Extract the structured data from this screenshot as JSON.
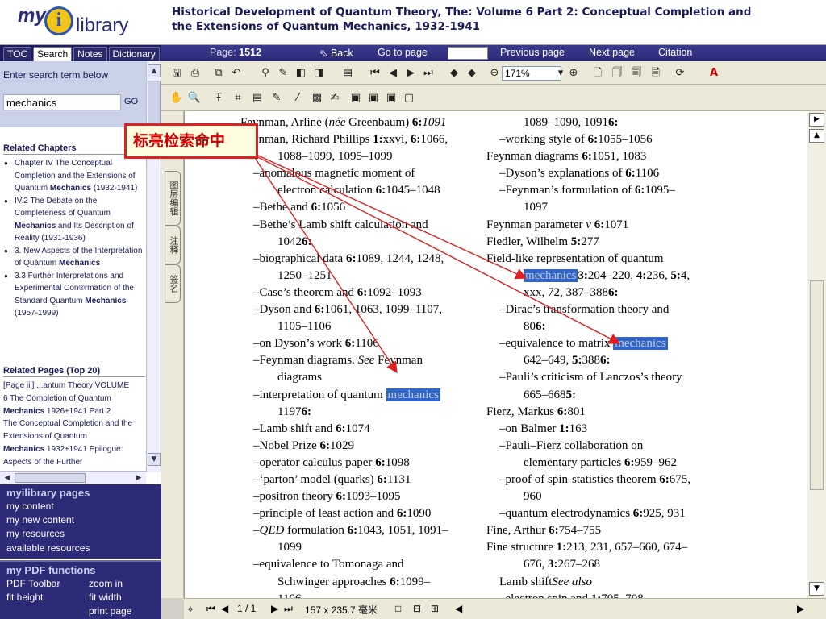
{
  "logo": {
    "my": "my",
    "i": "i",
    "library": "library"
  },
  "header": {
    "title": "Historical Development of Quantum Theory, The: Volume 6 Part 2: Conceptual Completion and the Extensions of Quantum Mechanics, 1932-1941"
  },
  "tabs": [
    "TOC",
    "Search",
    "Notes",
    "Dictionary"
  ],
  "nav": {
    "page_label": "Page:",
    "page_value": "1512",
    "back": "Back",
    "goto": "Go to page",
    "prev": "Previous page",
    "next": "Next page",
    "citation": "Citation"
  },
  "search": {
    "label": "Enter search term below",
    "value": "mechanics",
    "go": "GO"
  },
  "related_chapters": {
    "heading": "Related Chapters",
    "items": [
      {
        "pre": "Chapter IV The Conceptual Completion and the Extensions of Quantum ",
        "bold": "Mechanics",
        "post": " (1932-1941)"
      },
      {
        "pre": "IV.2 The Debate on the Completeness of Quantum ",
        "bold": "Mechanics",
        "post": " and Its Description of Reality (1931-1936)"
      },
      {
        "pre": "3. New Aspects of the Interpretation of Quantum ",
        "bold": "Mechanics",
        "post": ""
      },
      {
        "pre": "3.3 Further Interpretations and Experimental Con®rmation of the Standard Quantum ",
        "bold": "Mechanics",
        "post": " (1957-1999)"
      }
    ]
  },
  "related_pages": {
    "heading": "Related Pages (Top 20)",
    "lines": [
      {
        "text": "[Page iii] ...antum Theory VOLUME"
      },
      {
        "text": "6 The Completion of Quantum"
      },
      {
        "bold": "Mechanics",
        "text": " 1926±1941 Part 2"
      },
      {
        "text": "The Conceptual Completion and the"
      },
      {
        "text": "Extensions of Quantum"
      },
      {
        "bold": "Mechanics",
        "text": " 1932±1941 Epilogue:"
      },
      {
        "text": "Aspects of the Further"
      }
    ]
  },
  "mylibrary": {
    "heading": "myilibrary pages",
    "links": [
      "my content",
      "my new content",
      "my resources",
      "available resources"
    ]
  },
  "pdf_functions": {
    "heading": "my PDF functions",
    "links": [
      "PDF Toolbar",
      "zoom in",
      "fit height",
      "fit width",
      "print page"
    ]
  },
  "viewer": {
    "zoom": "171%",
    "page_indicator": "1 / 1",
    "page_size": "157 x 235.7 毫米",
    "side_tabs": [
      "图层编辑",
      "注释",
      "签名"
    ]
  },
  "annotation": {
    "text": "标亮检索命中"
  },
  "index_left": [
    {
      "cls": "",
      "t": "Feynman, Arline (",
      "i": "née",
      "t2": " Greenbaum)  ",
      "b": "6:",
      "i2": "1091"
    },
    {
      "cls": "",
      "t": "Feynman, Richard Phillips  ",
      "b": "1:",
      "t2": "xxvi, ",
      "b2": "6:",
      "t3": "1066,"
    },
    {
      "cls": "i2",
      "t": "1088–1099, 1095–1099"
    },
    {
      "cls": "i1",
      "t": "–anomalous magnetic moment of"
    },
    {
      "cls": "i2",
      "t": "electron calculation   ",
      "b": "6:",
      "t2": "1045–1048"
    },
    {
      "cls": "i1",
      "t": "–Bethe and   ",
      "b": "6:",
      "t2": "1056"
    },
    {
      "cls": "i1",
      "t": "–Bethe’s Lamb shift calculation and"
    },
    {
      "cls": "i2",
      "b": "6:",
      "t": "1042"
    },
    {
      "cls": "i1",
      "t": "–biographical data   ",
      "b": "6:",
      "t2": "1089, 1244, 1248,"
    },
    {
      "cls": "i2",
      "t": "1250–1251"
    },
    {
      "cls": "i1",
      "t": "–Case’s theorem and   ",
      "b": "6:",
      "t2": "1092–1093"
    },
    {
      "cls": "i1",
      "t": "–Dyson and   ",
      "b": "6:",
      "t2": "1061, 1063, 1099–1107,"
    },
    {
      "cls": "i2",
      "t": "1105–1106"
    },
    {
      "cls": "i1",
      "t": "–on Dyson’s work   ",
      "b": "6:",
      "t2": "1106"
    },
    {
      "cls": "i1",
      "t": "–Feynman diagrams. ",
      "i": "See",
      "t2": " Feynman"
    },
    {
      "cls": "i2",
      "t": "diagrams"
    },
    {
      "cls": "i1",
      "t": "–interpretation of quantum ",
      "hl": "mechanics"
    },
    {
      "cls": "i2",
      "b": "6:",
      "t": "1197"
    },
    {
      "cls": "i1",
      "t": "–Lamb shift and   ",
      "b": "6:",
      "t2": "1074"
    },
    {
      "cls": "i1",
      "t": "–Nobel Prize   ",
      "b": "6:",
      "t2": "1029"
    },
    {
      "cls": "i1",
      "t": "–operator calculus paper   ",
      "b": "6:",
      "t2": "1098"
    },
    {
      "cls": "i1",
      "t": "–‘parton’ model (quarks)   ",
      "b": "6:",
      "t2": "1131"
    },
    {
      "cls": "i1",
      "t": "–positron theory   ",
      "b": "6:",
      "t2": "1093–1095"
    },
    {
      "cls": "i1",
      "t": "–principle of least action and   ",
      "b": "6:",
      "t2": "1090"
    },
    {
      "cls": "i1",
      "t": "–",
      "i": "QED",
      "t2": " formulation   ",
      "b": "6:",
      "t3": "1043, 1051, 1091–"
    },
    {
      "cls": "i2",
      "t": "1099"
    },
    {
      "cls": "i1",
      "t": "–equivalence to Tomonaga and"
    },
    {
      "cls": "i2",
      "t": "Schwinger approaches   ",
      "b": "6:",
      "t2": "1099–"
    },
    {
      "cls": "i2",
      "t": "1106"
    }
  ],
  "index_right": [
    {
      "cls": "i2",
      "b": "6:",
      "t": "1089–1090, 1091"
    },
    {
      "cls": "i1",
      "t": "–working style of   ",
      "b": "6:",
      "t2": "1055–1056"
    },
    {
      "cls": "",
      "t": "Feynman diagrams   ",
      "b": "6:",
      "t2": "1051, 1083"
    },
    {
      "cls": "i1",
      "t": "–Dyson’s explanations of   ",
      "b": "6:",
      "t2": "1106"
    },
    {
      "cls": "i1",
      "t": "–Feynman’s formulation of   ",
      "b": "6:",
      "t2": "1095–"
    },
    {
      "cls": "i2",
      "t": "1097"
    },
    {
      "cls": "",
      "t": "Feynman parameter ",
      "i": "v",
      "t2": "   ",
      "b": "6:",
      "t3": "1071"
    },
    {
      "cls": "",
      "t": "Fiedler, Wilhelm   ",
      "b": "5:",
      "t2": "277"
    },
    {
      "cls": "",
      "t": "Field-like representation of quantum"
    },
    {
      "cls": "i2",
      "hl": "mechanics",
      "t": "  ",
      "b": "3:",
      "t2": "204–220, ",
      "b2": "4:",
      "t3": "236, ",
      "b3": "5:",
      "t4": "4,"
    },
    {
      "cls": "i2",
      "b": "6:",
      "t": "xxx, 72, 387–388"
    },
    {
      "cls": "i1",
      "t": "–Dirac’s transformation theory and"
    },
    {
      "cls": "i2",
      "b": "6:",
      "t": "80"
    },
    {
      "cls": "i1",
      "t": "–equivalence to matrix ",
      "hl": "mechanics"
    },
    {
      "cls": "i2",
      "b": "5:",
      "t": "642–649, ",
      "b2": "6:",
      "t2": "388"
    },
    {
      "cls": "i1",
      "t": "–Pauli’s criticism of Lanczos’s theory"
    },
    {
      "cls": "i2",
      "b": "5:",
      "t": "665–668"
    },
    {
      "cls": "",
      "t": "Fierz, Markus   ",
      "b": "6:",
      "t2": "801"
    },
    {
      "cls": "i1",
      "t": "–on Balmer   ",
      "b": "1:",
      "t2": "163"
    },
    {
      "cls": "i1",
      "t": "–Pauli–Fierz collaboration on"
    },
    {
      "cls": "i2",
      "t": "elementary particles   ",
      "b": "6:",
      "t2": "959–962"
    },
    {
      "cls": "i1",
      "t": "–proof of spin-statistics theorem   ",
      "b": "6:",
      "t2": "675,"
    },
    {
      "cls": "i2",
      "t": "960"
    },
    {
      "cls": "i1",
      "t": "–quantum electrodynamics   ",
      "b": "6:",
      "t2": "925, 931"
    },
    {
      "cls": "",
      "t": "Fine, Arthur   ",
      "b": "6:",
      "t2": "754–755"
    },
    {
      "cls": "",
      "t": "Fine structure   ",
      "b": "1:",
      "t2": "213, 231, 657–660, 674–"
    },
    {
      "cls": "i2",
      "t": "676, ",
      "b": "3:",
      "t2": "267–268"
    },
    {
      "cls": "i1",
      "i": "See also",
      "t": " Lamb shift"
    },
    {
      "cls": "i1",
      "t": "–electron spin and   ",
      "b": "1:",
      "t2": "705–708"
    }
  ]
}
